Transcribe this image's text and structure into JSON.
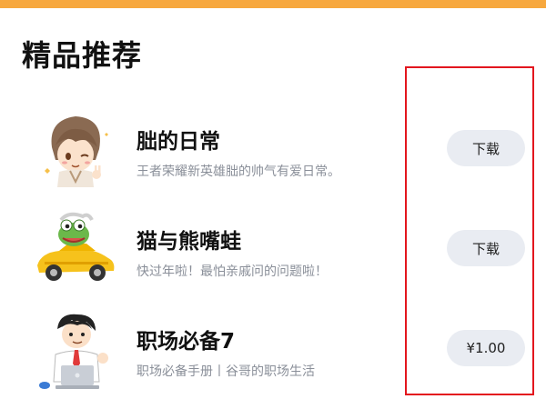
{
  "accent_color": "#f7a83e",
  "highlight_color": "#e3161e",
  "section": {
    "title": "精品推荐"
  },
  "items": [
    {
      "title": "朏的日常",
      "description": "王者荣耀新英雄朏的帅气有爱日常。",
      "action_label": "下载",
      "thumbnail_icon": "chibi-hero-sticker"
    },
    {
      "title": "猫与熊嘴蛙",
      "description": "快过年啦！最怕亲戚问的问题啦！",
      "action_label": "下载",
      "thumbnail_icon": "frog-in-yellow-car-sticker"
    },
    {
      "title": "职场必备7",
      "description": "职场必备手册丨谷哥的职场生活",
      "action_label": "¥1.00",
      "thumbnail_icon": "office-man-laptop-sticker"
    }
  ]
}
